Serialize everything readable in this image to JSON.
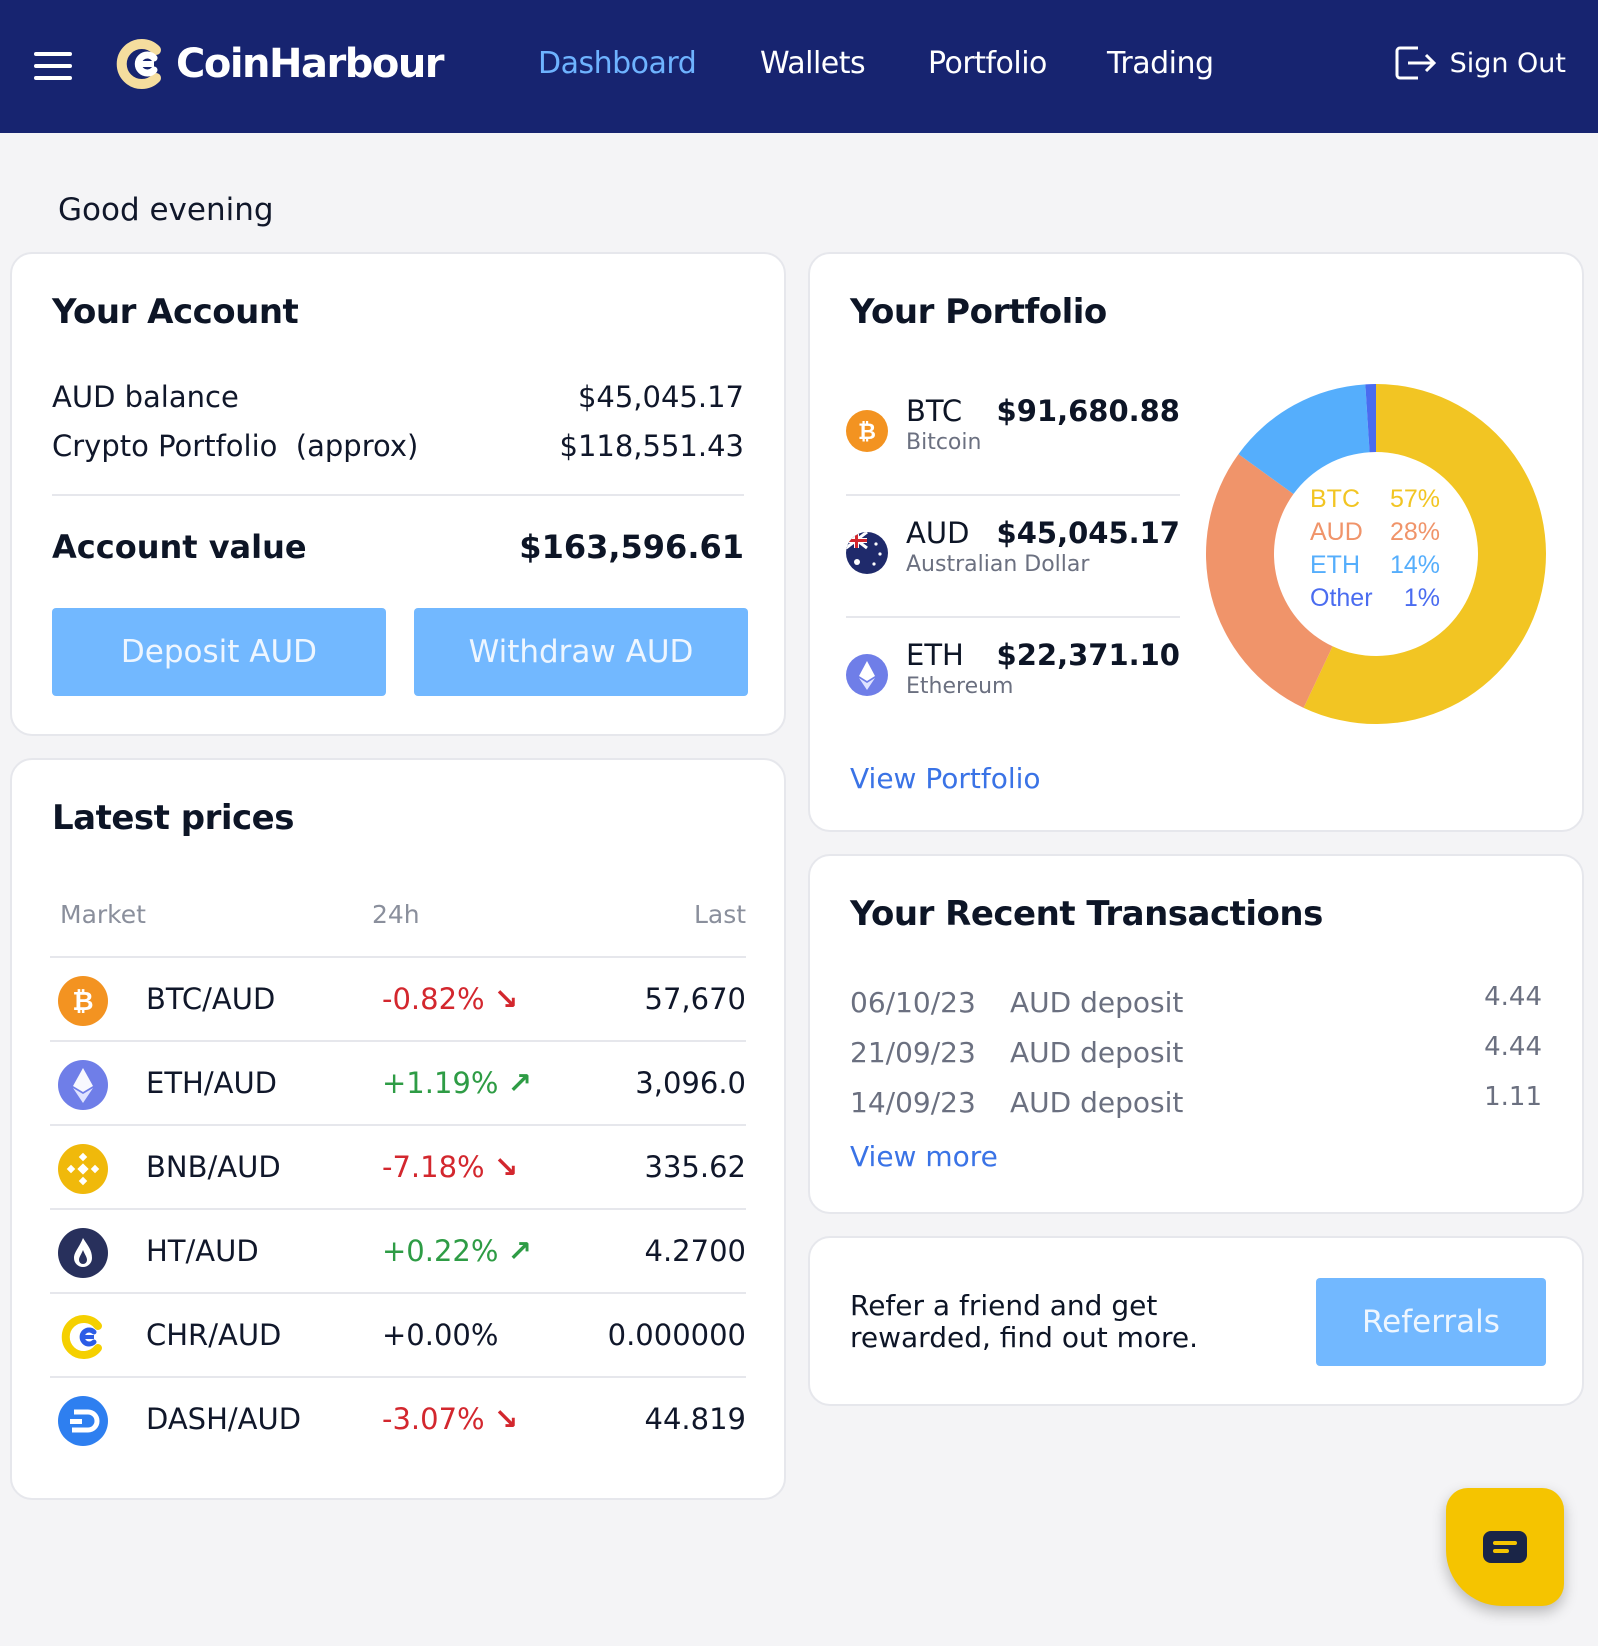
{
  "header": {
    "brand": "CoinHarbour",
    "nav": [
      "Dashboard",
      "Wallets",
      "Portfolio",
      "Trading"
    ],
    "active_nav": "Dashboard",
    "sign_out": "Sign Out",
    "icons": [
      "menu-icon",
      "coinharbour-logo",
      "sign-out-icon"
    ],
    "colors": {
      "background": "#172470",
      "active": "#6eb3ff"
    }
  },
  "greeting": "Good evening",
  "account": {
    "title": "Your Account",
    "aud_balance_label": "AUD balance",
    "aud_balance_value": "$45,045.17",
    "crypto_label": "Crypto Portfolio  (approx)",
    "crypto_value": "$118,551.43",
    "account_value_label": "Account value",
    "account_value": "$163,596.61",
    "deposit_button": "Deposit AUD",
    "withdraw_button": "Withdraw AUD"
  },
  "prices": {
    "title": "Latest prices",
    "headers": {
      "market": "Market",
      "change": "24h",
      "last": "Last"
    },
    "rows": [
      {
        "icon": "btc-icon",
        "market": "BTC/AUD",
        "change": "-0.82%",
        "direction": "down",
        "last": "57,670"
      },
      {
        "icon": "eth-icon",
        "market": "ETH/AUD",
        "change": "+1.19%",
        "direction": "up",
        "last": "3,096.0"
      },
      {
        "icon": "bnb-icon",
        "market": "BNB/AUD",
        "change": "-7.18%",
        "direction": "down",
        "last": "335.62"
      },
      {
        "icon": "ht-icon",
        "market": "HT/AUD",
        "change": "+0.22%",
        "direction": "up",
        "last": "4.2700"
      },
      {
        "icon": "chr-icon",
        "market": "CHR/AUD",
        "change": "+0.00%",
        "direction": "flat",
        "last": "0.000000"
      },
      {
        "icon": "dash-icon",
        "market": "DASH/AUD",
        "change": "-3.07%",
        "direction": "down",
        "last": "44.819"
      }
    ],
    "colors": {
      "negative": "#d3272e",
      "positive": "#2e9c45"
    }
  },
  "portfolio": {
    "title": "Your Portfolio",
    "holdings": [
      {
        "icon": "btc-icon",
        "symbol": "BTC",
        "name": "Bitcoin",
        "amount": "$91,680.88"
      },
      {
        "icon": "australian-flag-icon",
        "symbol": "AUD",
        "name": "Australian Dollar",
        "amount": "$45,045.17"
      },
      {
        "icon": "eth-icon",
        "symbol": "ETH",
        "name": "Ethereum",
        "amount": "$22,371.10"
      }
    ],
    "view_link": "View Portfolio"
  },
  "chart_data": {
    "type": "pie",
    "title": "",
    "categories": [
      "BTC",
      "AUD",
      "ETH",
      "Other"
    ],
    "values": [
      57,
      28,
      14,
      1
    ],
    "labels": [
      "57%",
      "28%",
      "14%",
      "1%"
    ],
    "colors": [
      "#f2c523",
      "#f0946a",
      "#55aefc",
      "#4a6cf0"
    ],
    "donut": true,
    "legend_placement": "center"
  },
  "transactions": {
    "title": "Your Recent Transactions",
    "rows": [
      {
        "date": "06/10/23",
        "description": "AUD deposit",
        "amount": "4.44"
      },
      {
        "date": "21/09/23",
        "description": "AUD deposit",
        "amount": "4.44"
      },
      {
        "date": "14/09/23",
        "description": "AUD deposit",
        "amount": "1.11"
      }
    ],
    "view_more": "View more"
  },
  "referral": {
    "text_line1": "Refer a friend and get",
    "text_line2": "rewarded, find out more.",
    "button": "Referrals"
  },
  "chat": {
    "icon": "chat-icon",
    "color": "#f5c400"
  }
}
